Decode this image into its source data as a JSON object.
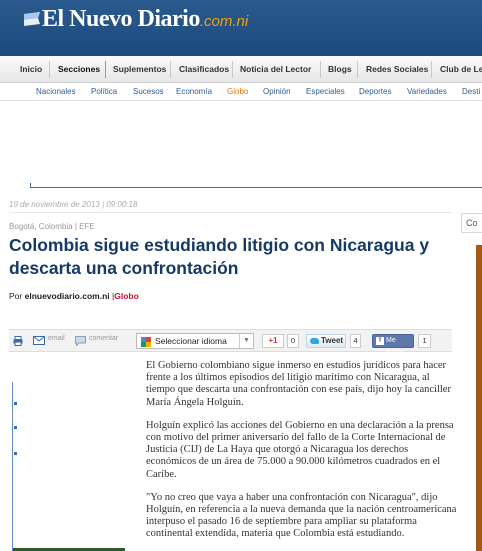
{
  "header": {
    "logo_text": "El Nuevo Diario",
    "logo_domain": ".com.ni",
    "logo_icon": "flag-icon"
  },
  "main_nav": [
    "Inicio",
    "Secciones",
    "Suplementos",
    "Clasificados",
    "Noticia del Lector",
    "Blogs",
    "Redes Sociales",
    "Club de Le"
  ],
  "sub_nav": [
    "Nacionales",
    "Política",
    "Sucesos",
    "Economía",
    "Globo",
    "Opinión",
    "Especiales",
    "Deportes",
    "Variedades",
    "Desti"
  ],
  "article": {
    "date": "19 de noviembre de 2013 | 09:00:18",
    "dateline": "Bogotá, Colombia | EFE",
    "title": "Colombia sigue estudiando litigio con Nicaragua y descarta una confrontación",
    "byline_prefix": "Por",
    "byline_author": "elnuevodiario.com.ni",
    "byline_sep": "|",
    "byline_section": "Globo",
    "paragraphs": [
      "El Gobierno colombiano sigue inmerso en estudios jurídicos para hacer frente a los últimos episodios del litigio marítimo con Nicaragua, al tiempo que descarta una confrontación con ese país, dijo hoy la canciller María Ángela Holguín.",
      "Holguín explicó las acciones del Gobierno en una declaración a la prensa con motivo del primer aniversario del fallo de la Corte Internacional de Justicia (CIJ) de La Haya que otorgó a Nicaragua los derechos económicos de un área de 75.000 a 90.000 kilómetros cuadrados en el Caribe.",
      "\"Yo no creo que vaya a haber una confrontación con Nicaragua\", dijo Holguín, en referencia a la nueva demanda que la nación centroamericana interpuso el pasado 16 de septiembre para ampliar su plataforma continental extendida, materia que Colombia está estudiando."
    ]
  },
  "toolbar": {
    "email": "email",
    "comment": "comentar",
    "language_select": "Seleccionar idioma",
    "gplus_label": "+1",
    "gplus_count": "0",
    "tweet_label": "Tweet",
    "tweet_count": "4",
    "like_label": "Me gusta",
    "like_count": "1"
  },
  "right_tab": "Co",
  "colors": {
    "header_bg": "#1c4a7c",
    "title_color": "#153a66",
    "accent_orange": "#e07b00",
    "section_red": "#c8102e"
  }
}
